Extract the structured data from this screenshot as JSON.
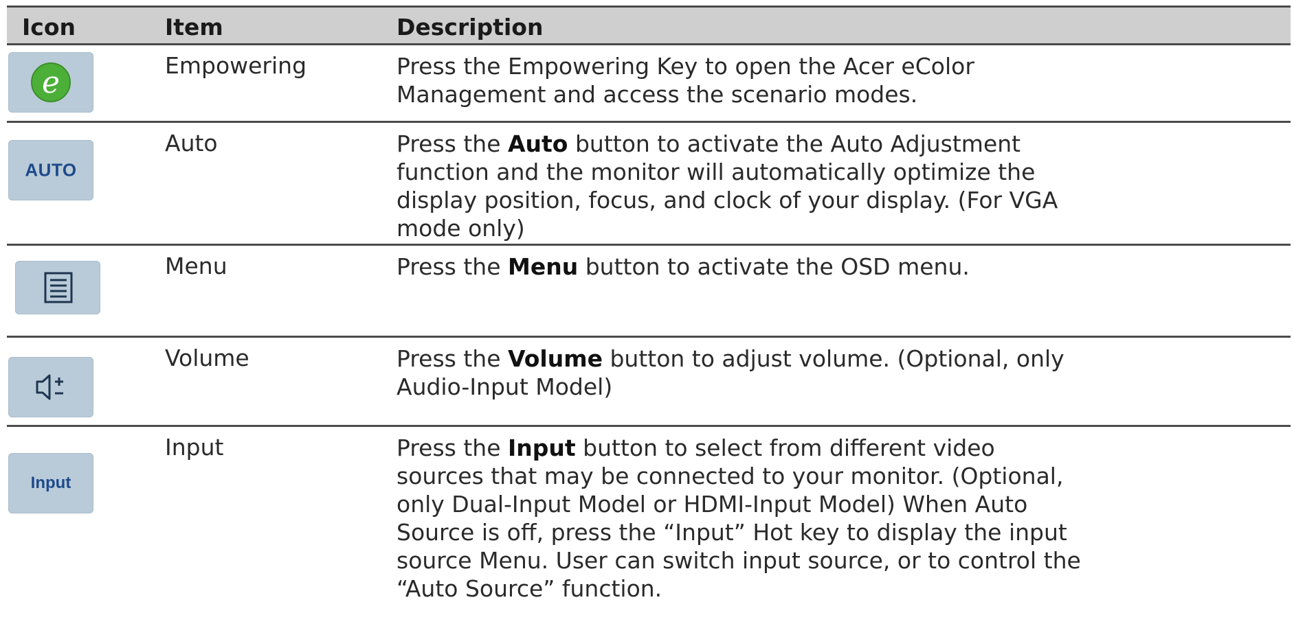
{
  "table": {
    "headers": {
      "icon": "Icon",
      "item": "Item",
      "description": "Description"
    },
    "rows": [
      {
        "icon": "empowering-e-icon",
        "item": "Empowering",
        "desc_lines": [
          "Press the Empowering Key to open the Acer eColor",
          "Management and access the scenario modes."
        ]
      },
      {
        "icon": "auto-key-icon",
        "icon_label": "AUTO",
        "item": "Auto",
        "desc_pre": "Press the ",
        "desc_bold": "Auto",
        "desc_l1_rest": " button to activate the Auto Adjustment",
        "desc_lines_rest": [
          "function and the monitor will automatically optimize the",
          "display position, focus, and clock of your display. (For VGA",
          "mode only)"
        ]
      },
      {
        "icon": "menu-key-icon",
        "item": "Menu",
        "desc_pre": "Press the ",
        "desc_bold": "Menu",
        "desc_l1_rest": " button to activate the OSD menu."
      },
      {
        "icon": "volume-key-icon",
        "item": "Volume",
        "desc_pre": "Press the ",
        "desc_bold": "Volume",
        "desc_l1_rest": " button to adjust volume. (Optional, only",
        "desc_lines_rest": [
          "Audio-Input Model)"
        ]
      },
      {
        "icon": "input-key-icon",
        "icon_label": "Input",
        "item": "Input",
        "desc_pre": "Press the ",
        "desc_bold": "Input",
        "desc_l1_rest": " button to select from different video",
        "desc_lines_rest": [
          "sources that may be connected to your monitor. (Optional,",
          "only Dual-Input Model or HDMI-Input Model) When Auto",
          "Source is off, press the “Input” Hot key to display the input",
          "source Menu. User can switch input source, or to control the",
          "“Auto Source” function."
        ]
      }
    ]
  },
  "colors": {
    "header_bg": "#cfcfcf",
    "key_bg": "#b9cbd8",
    "e_green": "#4caf38",
    "key_text_blue": "#1e4a8a",
    "rule": "#4a4a4a"
  }
}
